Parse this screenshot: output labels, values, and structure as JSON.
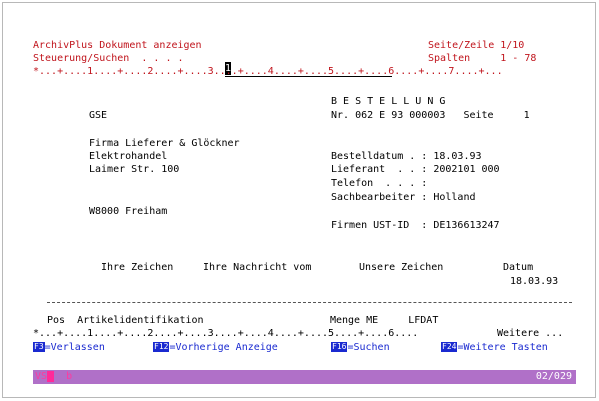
{
  "header": {
    "title": "ArchivPlus Dokument anzeigen",
    "steuerung_label": "Steuerung/Suchen  . . . . ",
    "steuerung_value": "1",
    "cursor_char": "1",
    "seite_zeile": "Seite/Zeile 1/10",
    "spalten": "Spalten     1 - 78",
    "ruler": "*...+....1....+....2....+....3....+....4....+....5....+....6....+....7....+..."
  },
  "document": {
    "heading": "B E S T E L L U N G",
    "company": "GSE",
    "nr_line": "Nr. 062 E 93 000003   Seite     1",
    "address": [
      "Firma Lieferer & Glöckner",
      "Elektrohandel",
      "Laimer Str. 100"
    ],
    "city": "W8000 Freiham",
    "details": [
      "Bestelldatum . : 18.03.93",
      "Lieferant  . . : 2002101 000",
      "Telefon  . . . :",
      "Sachbearbeiter : Holland"
    ],
    "ust_id": "Firmen UST-ID  : DE136613247",
    "ref_headers": [
      "Ihre Zeichen",
      "Ihre Nachricht vom",
      "Unsere Zeichen",
      "Datum"
    ],
    "ref_date": "18.03.93",
    "table_header": "Pos  Artikelidentifikation                     Menge ME     LFDAT",
    "ruler_bottom": "*...+....1....+....2....+....3....+....4....+....5....+....6....",
    "weitere": "Weitere ..."
  },
  "function_keys": [
    {
      "key": "F3",
      "label": "=Verlassen"
    },
    {
      "key": "F12",
      "label": "=Vorherige Anzeige"
    },
    {
      "key": "F16",
      "label": "=Suchen"
    },
    {
      "key": "F24",
      "label": "=Weitere Tasten"
    }
  ],
  "status_bar": {
    "left_text": "b",
    "left_code": "VS",
    "right_text": "02/029"
  },
  "colors": {
    "text_red": "#c0141c",
    "text_blue": "#1a2ad0",
    "status_bg": "#b070c8",
    "status_mark": "#ff2a9a"
  }
}
